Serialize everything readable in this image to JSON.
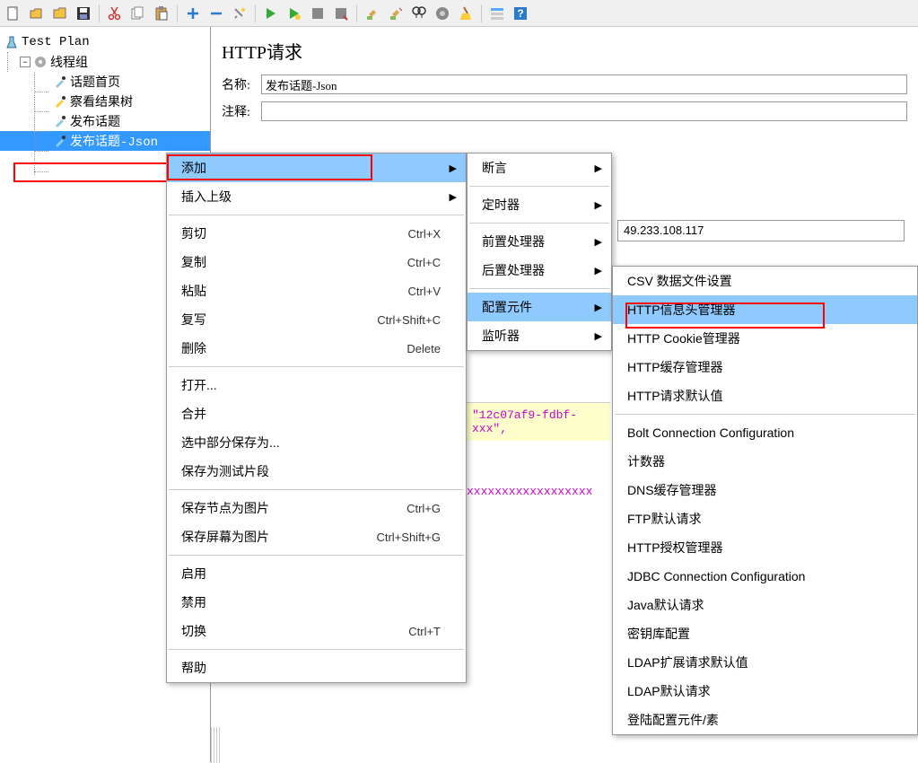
{
  "toolbar_icons": [
    "new",
    "open",
    "folder",
    "save",
    "sep",
    "cut",
    "copy",
    "paste",
    "sep",
    "plus",
    "minus",
    "wand",
    "sep",
    "play",
    "play-check",
    "stop",
    "stop-all",
    "sep",
    "broom",
    "broom-all",
    "find",
    "gear",
    "tips",
    "sep",
    "list",
    "help"
  ],
  "tree": {
    "root": "Test Plan",
    "thread_group": "线程组",
    "items": [
      "话题首页",
      "察看结果树",
      "发布话题",
      "发布话题-Json"
    ]
  },
  "panel": {
    "title": "HTTP请求",
    "name_label": "名称:",
    "name_value": "发布话题-Json",
    "comment_label": "注释:",
    "comment_value": ""
  },
  "ip_value": "49.233.108.117",
  "code": {
    "line1": "\"12c07af9-fdbf-",
    "line2": "xxx\",",
    "overflow": "xxxxxxxxxxxxxxxxxx"
  },
  "menu1": [
    {
      "label": "添加",
      "arrow": true,
      "hl": true
    },
    {
      "label": "插入上级",
      "arrow": true
    },
    {
      "sep": true
    },
    {
      "label": "剪切",
      "shortcut": "Ctrl+X"
    },
    {
      "label": "复制",
      "shortcut": "Ctrl+C"
    },
    {
      "label": "粘贴",
      "shortcut": "Ctrl+V"
    },
    {
      "label": "复写",
      "shortcut": "Ctrl+Shift+C"
    },
    {
      "label": "删除",
      "shortcut": "Delete"
    },
    {
      "sep": true
    },
    {
      "label": "打开..."
    },
    {
      "label": "合并"
    },
    {
      "label": "选中部分保存为..."
    },
    {
      "label": "保存为测试片段"
    },
    {
      "sep": true
    },
    {
      "label": "保存节点为图片",
      "shortcut": "Ctrl+G"
    },
    {
      "label": "保存屏幕为图片",
      "shortcut": "Ctrl+Shift+G"
    },
    {
      "sep": true
    },
    {
      "label": "启用"
    },
    {
      "label": "禁用"
    },
    {
      "label": "切换",
      "shortcut": "Ctrl+T"
    },
    {
      "sep": true
    },
    {
      "label": "帮助"
    }
  ],
  "menu2": [
    {
      "label": "断言",
      "arrow": true
    },
    {
      "sep": true
    },
    {
      "label": "定时器",
      "arrow": true
    },
    {
      "sep": true
    },
    {
      "label": "前置处理器",
      "arrow": true
    },
    {
      "label": "后置处理器",
      "arrow": true
    },
    {
      "sep": true
    },
    {
      "label": "配置元件",
      "arrow": true,
      "hl": true
    },
    {
      "label": "监听器",
      "arrow": true
    }
  ],
  "menu3": [
    {
      "label": "CSV 数据文件设置"
    },
    {
      "label": "HTTP信息头管理器",
      "hl": true
    },
    {
      "label": "HTTP Cookie管理器"
    },
    {
      "label": "HTTP缓存管理器"
    },
    {
      "label": "HTTP请求默认值"
    },
    {
      "sep": true
    },
    {
      "label": "Bolt Connection Configuration"
    },
    {
      "label": "计数器"
    },
    {
      "label": "DNS缓存管理器"
    },
    {
      "label": "FTP默认请求"
    },
    {
      "label": "HTTP授权管理器"
    },
    {
      "label": "JDBC Connection Configuration"
    },
    {
      "label": "Java默认请求"
    },
    {
      "label": "密钥库配置"
    },
    {
      "label": "LDAP扩展请求默认值"
    },
    {
      "label": "LDAP默认请求"
    },
    {
      "label": "登陆配置元件/素"
    }
  ]
}
